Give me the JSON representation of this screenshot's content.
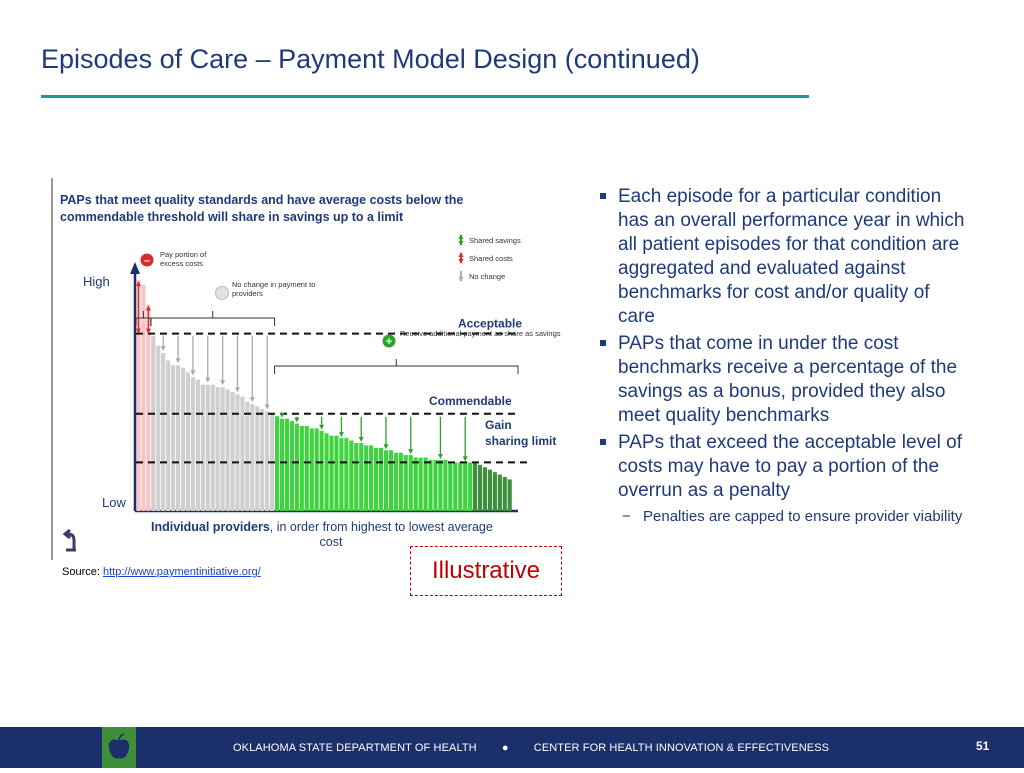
{
  "page": {
    "title": "Episodes of Care – Payment Model Design (continued)",
    "page_number": "51"
  },
  "chart_data": {
    "type": "bar",
    "title": "PAPs that meet quality standards and have average costs below the commendable threshold will share in savings up to a limit",
    "xlabel_bold": "Individual providers",
    "xlabel_rest": ", in order from highest to lowest average cost",
    "y_high_label": "High",
    "y_low_label": "Low",
    "ylim": [
      0,
      100
    ],
    "thresholds": [
      {
        "name": "Acceptable",
        "value": 73
      },
      {
        "name": "Commendable",
        "value": 40
      },
      {
        "name": "Gain sharing limit",
        "value": 20
      }
    ],
    "legend": [
      {
        "label": "Shared savings",
        "color": "#2aa52a"
      },
      {
        "label": "Shared costs",
        "color": "#d92c2c"
      },
      {
        "label": "No change",
        "color": "#aaaaaa"
      }
    ],
    "annotations": {
      "penalty": "Pay portion of excess costs",
      "no_change": "No change in payment to providers",
      "bonus": "Receive additional payment as share as savings"
    },
    "groups": [
      {
        "name": "Shared costs",
        "color": "#f6c4c4",
        "values": [
          95,
          93,
          85
        ]
      },
      {
        "name": "No change",
        "color": "#cfcfcf",
        "values": [
          72,
          68,
          65,
          62,
          60,
          60,
          59,
          57,
          55,
          54,
          52,
          52,
          52,
          51,
          51,
          50,
          49,
          48,
          47,
          45,
          44,
          43,
          42,
          41,
          40
        ]
      },
      {
        "name": "Shared savings",
        "color": "#3fd43f",
        "values": [
          39,
          38,
          38,
          37,
          36,
          35,
          35,
          34,
          34,
          33,
          32,
          31,
          31,
          30,
          30,
          29,
          28,
          28,
          27,
          27,
          26,
          26,
          25,
          25,
          24,
          24,
          23,
          23,
          22,
          22,
          22,
          21,
          21,
          21,
          21,
          20,
          20,
          20,
          20,
          20
        ]
      },
      {
        "name": "Gain sharing limit",
        "color": "#3f8f3f",
        "values": [
          20,
          19,
          18,
          17,
          16,
          15,
          14,
          13
        ]
      }
    ]
  },
  "source": {
    "label": "Source:",
    "link": "http://www.paymentinitiative.org/"
  },
  "illustrative": "Illustrative",
  "bullets": [
    "Each episode for a particular condition has an overall performance year in which all patient episodes for that condition are aggregated and evaluated against benchmarks for cost and/or quality of care",
    "PAPs that come in under the cost benchmarks receive a percentage of the savings as a bonus, provided they also meet quality benchmarks",
    "PAPs that exceed the acceptable level of costs may have to pay a portion of the overrun as a penalty"
  ],
  "sub_bullet": "Penalties are capped to ensure provider viability",
  "footer": {
    "org": "OKLAHOMA STATE DEPARTMENT OF HEALTH",
    "separator": "●",
    "center": "CENTER FOR HEALTH INNOVATION & EFFECTIVENESS"
  },
  "colors": {
    "title": "#1f3a7a",
    "rule": "#1a9a9a",
    "footer": "#1b2f6b",
    "penalty": "#c00000"
  }
}
